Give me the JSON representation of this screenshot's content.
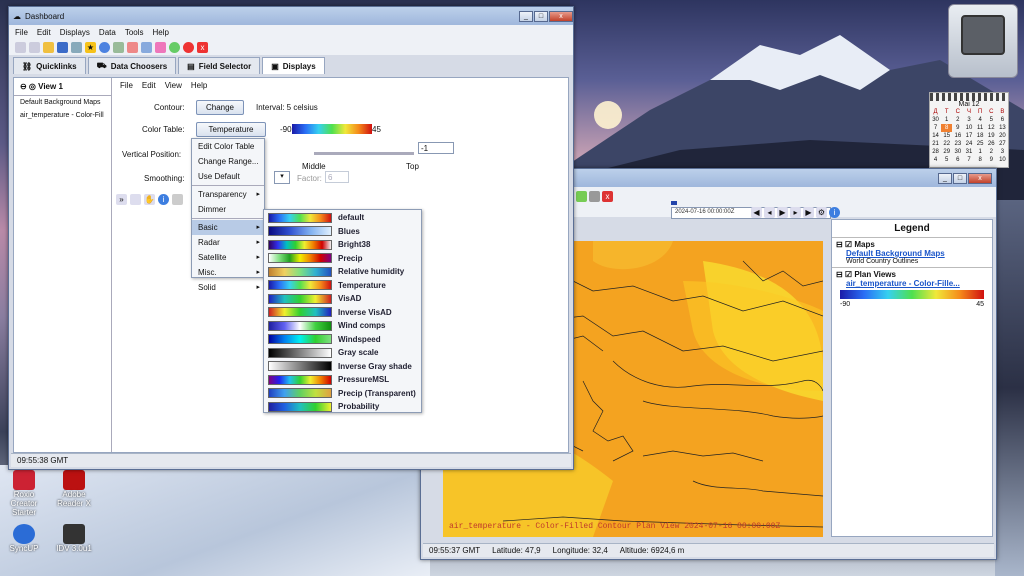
{
  "dashboard": {
    "title": "Dashboard",
    "menu": [
      "File",
      "Edit",
      "Displays",
      "Data",
      "Tools",
      "Help"
    ],
    "tabs": [
      "Quicklinks",
      "Data Choosers",
      "Field Selector",
      "Displays"
    ],
    "view_label": "View 1",
    "layers": [
      "Default Background Maps",
      "air_temperature - Color-Fill"
    ],
    "submenu": [
      "File",
      "Edit",
      "View",
      "Help"
    ],
    "contour_label": "Contour:",
    "change_btn": "Change",
    "interval_text": "Interval: 5 celsius",
    "color_table_label": "Color Table:",
    "color_table_btn": "Temperature",
    "scale_min": "-90",
    "scale_max": "45",
    "vertical_label": "Vertical Position:",
    "vertical_value": "-1",
    "pos_middle": "Middle",
    "pos_top": "Top",
    "smoothing_label": "Smoothing:",
    "factor_label": "Factor:",
    "factor_value": "6",
    "status_time": "09:55:38 GMT"
  },
  "ctmenu": {
    "items": [
      "Edit Color Table",
      "Change Range...",
      "Use Default"
    ],
    "group2": [
      "Transparency",
      "Dimmer"
    ],
    "categories": [
      "Basic",
      "Radar",
      "Satellite",
      "Misc.",
      "Solid"
    ],
    "tables": [
      "default",
      "Blues",
      "Bright38",
      "Precip",
      "Relative humidity",
      "Temperature",
      "VisAD",
      "Inverse VisAD",
      "Wind comps",
      "Windspeed",
      "Gray scale",
      "Inverse Gray shade",
      "PressureMSL",
      "Precip (Transparent)",
      "Probability"
    ]
  },
  "map": {
    "time": "2024-07-16 00:00:00Z",
    "overlay_text": "air_temperature - Color-Filled Contour Plan View 2024-07-16 00:00:00Z",
    "status_time": "09:55:37 GMT",
    "latitude": "Latitude: 47,9",
    "longitude": "Longitude: 32,4",
    "altitude": "Altitude: 6924,6 m"
  },
  "legend": {
    "title": "Legend",
    "maps": "Maps",
    "bg_maps": "Default Background Maps",
    "bg_sub": "World Country Outlines",
    "plan_views": "Plan Views",
    "air_temp": "air_temperature - Color-Fille...",
    "min": "-90",
    "max": "45"
  },
  "calendar": {
    "month": "Mai 12",
    "days": [
      "Д",
      "Т",
      "С",
      "Ч",
      "П",
      "С",
      "В"
    ],
    "rows": [
      [
        "30",
        "1",
        "2",
        "3",
        "4",
        "5",
        "6"
      ],
      [
        "7",
        "8",
        "9",
        "10",
        "11",
        "12",
        "13"
      ],
      [
        "14",
        "15",
        "16",
        "17",
        "18",
        "19",
        "20"
      ],
      [
        "21",
        "22",
        "23",
        "24",
        "25",
        "26",
        "27"
      ],
      [
        "28",
        "29",
        "30",
        "31",
        "1",
        "2",
        "3"
      ],
      [
        "4",
        "5",
        "6",
        "7",
        "8",
        "9",
        "10"
      ]
    ]
  },
  "desktop": {
    "icons": [
      "Roxio Creator Starter",
      "Adobe Reader X",
      "SyncUP",
      "IDV 3.0u1"
    ]
  },
  "colors": {
    "accent": "#f5a623",
    "titlebar": "#a9c0e0",
    "map_orange": "#f6a51d",
    "map_yellow": "#f8d22c"
  }
}
